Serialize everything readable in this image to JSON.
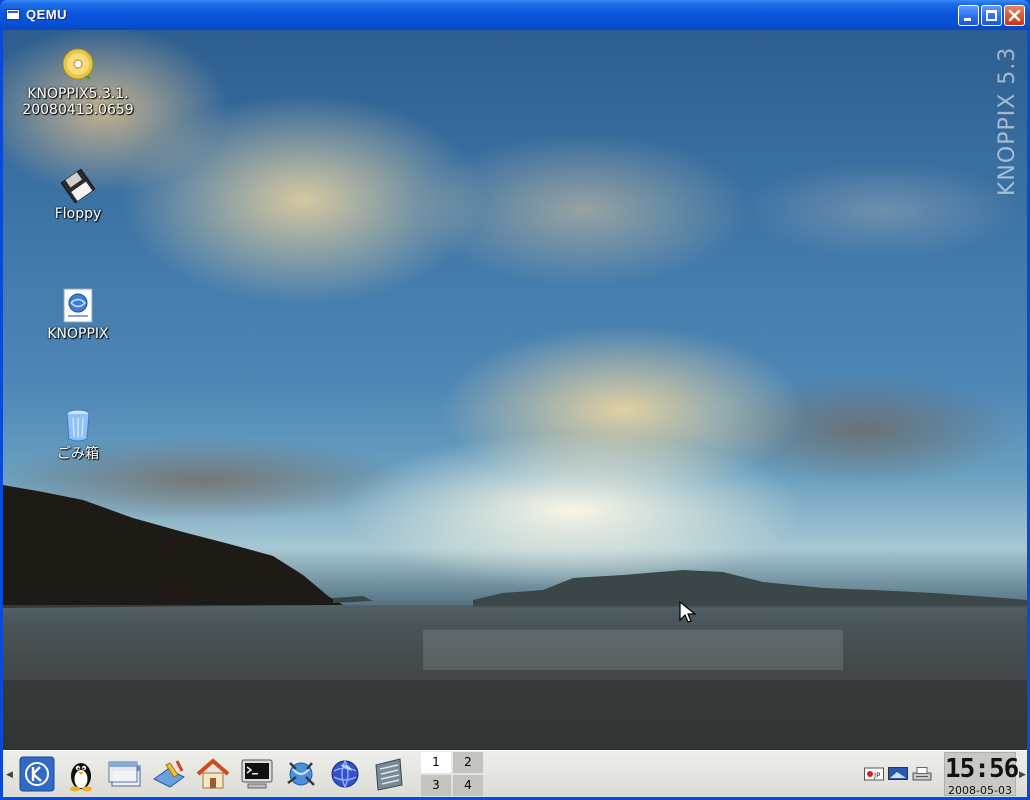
{
  "window": {
    "title": "QEMU",
    "buttons": {
      "minimize": "minimize",
      "maximize": "maximize",
      "close": "close"
    }
  },
  "desktop": {
    "watermark": "KNOPPIX 5.3",
    "icons": [
      {
        "label": "KNOPPIX5.3.1.\n20080413.0659",
        "line1": "KNOPPIX5.3.1.",
        "line2": "20080413.0659",
        "icon": "cdrom-icon"
      },
      {
        "label": "Floppy",
        "icon": "floppy-icon"
      },
      {
        "label": "KNOPPIX",
        "icon": "knoppix-doc-icon"
      },
      {
        "label": "ごみ箱",
        "icon": "trash-icon"
      }
    ]
  },
  "taskbar": {
    "launchers": [
      {
        "name": "kde-menu-icon"
      },
      {
        "name": "tux-icon"
      },
      {
        "name": "window-list-icon"
      },
      {
        "name": "desktop-icon"
      },
      {
        "name": "home-icon"
      },
      {
        "name": "terminal-icon"
      },
      {
        "name": "konqueror-icon"
      },
      {
        "name": "browser-globe-icon"
      },
      {
        "name": "office-icon"
      }
    ],
    "pager": [
      {
        "label": "1",
        "active": true
      },
      {
        "label": "2",
        "active": false
      },
      {
        "label": "3",
        "active": false
      },
      {
        "label": "4",
        "active": false
      }
    ],
    "tray": [
      {
        "name": "jp-input-icon",
        "label": "JP"
      },
      {
        "name": "display-icon"
      },
      {
        "name": "printer-icon"
      }
    ],
    "clock": {
      "time": "15:56",
      "date": "2008-05-03"
    }
  }
}
